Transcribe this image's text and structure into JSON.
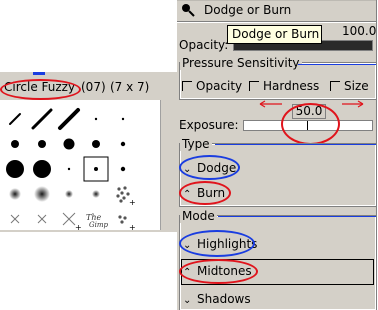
{
  "brush_selector": {
    "brush_name": "Circle Fuzzy",
    "spacing": "(07)",
    "size": "(7 x 7)",
    "brush_icons": [
      "diagonal-small-line",
      "diagonal-line",
      "diagonal-large-line",
      "dot-tiny",
      "dot-tiny",
      "dot-medium",
      "dot-medium",
      "dot-large",
      "dot-medium",
      "dot-small",
      "dot-xlarge",
      "dot-xlarge",
      "dot-tiny",
      "dot-selected",
      "dot-small",
      "fuzzy-medium",
      "fuzzy-large",
      "fuzzy-small",
      "fuzzy-small",
      "pepper",
      "cross",
      "cross",
      "cross-large",
      "gimp-text",
      "pepper-small"
    ]
  },
  "tool_options": {
    "title": "Dodge or Burn",
    "opacity": {
      "label": "Opacity:",
      "value": "100.0",
      "fraction": 1.0
    },
    "tooltip": "Dodge or Burn",
    "pressure_sensitivity": {
      "title": "Pressure Sensitivity",
      "options": [
        "Opacity",
        "Hardness",
        "Size"
      ]
    },
    "exposure": {
      "label": "Exposure:",
      "value": "50.0",
      "fraction": 0.5
    },
    "type": {
      "title": "Type",
      "options": [
        "Dodge",
        "Burn"
      ]
    },
    "mode": {
      "title": "Mode",
      "options": [
        "Highlights",
        "Midtones",
        "Shadows"
      ]
    }
  },
  "colors": {
    "panel_bg": "#d4d0c8",
    "annotation_red": "#e0141c",
    "annotation_blue": "#1a3de0"
  }
}
